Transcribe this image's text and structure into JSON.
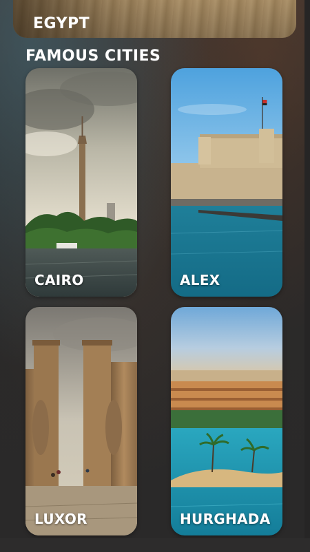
{
  "hero": {
    "title": "EGYPT"
  },
  "section": {
    "title": "FAMOUS CITIES"
  },
  "cities": [
    {
      "name": "CAIRO",
      "image": "cairo-tower-photo"
    },
    {
      "name": "ALEX",
      "image": "qaitbay-citadel-photo"
    },
    {
      "name": "LUXOR",
      "image": "luxor-temple-photo"
    },
    {
      "name": "HURGHADA",
      "image": "hurghada-resort-photo"
    }
  ],
  "colors": {
    "background": "#2b2a2a",
    "text": "#ffffff",
    "sea": "#1f8fa8",
    "sky": "#6fb6e6",
    "sand": "#c9a877"
  }
}
